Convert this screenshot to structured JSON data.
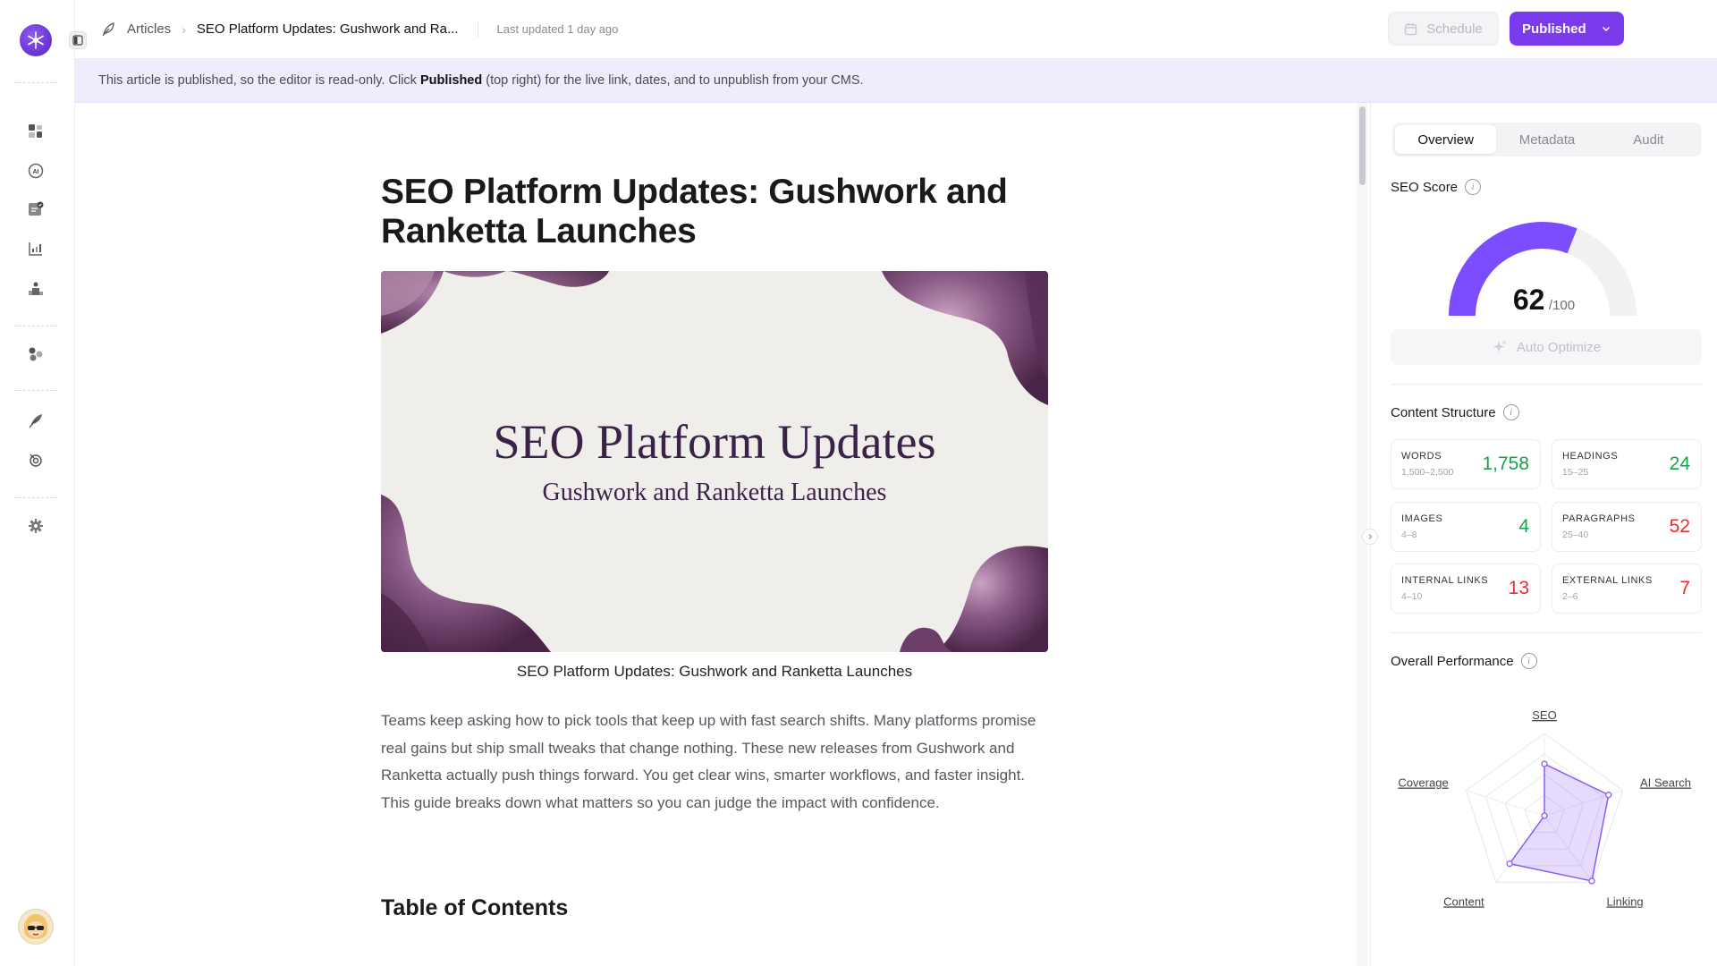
{
  "topbar": {
    "breadcrumb_root": "Articles",
    "breadcrumb_current": "SEO Platform Updates: Gushwork and Ra...",
    "last_updated": "Last updated 1 day ago",
    "schedule_label": "Schedule",
    "published_label": "Published"
  },
  "banner": {
    "text_before": "This article is published, so the editor is read-only. Click",
    "text_bold": "Published",
    "text_after": "(top right) for the live link, dates, and to unpublish from your CMS."
  },
  "article": {
    "title": "SEO Platform Updates: Gushwork and Ranketta Launches",
    "hero_title": "SEO Platform Updates",
    "hero_subtitle": "Gushwork and Ranketta Launches",
    "caption": "SEO Platform Updates: Gushwork and Ranketta Launches",
    "lead": "Teams keep asking how to pick tools that keep up with fast search shifts. Many platforms promise real gains but ship small tweaks that change nothing. These new releases from Gushwork and Ranketta actually push things forward. You get clear wins, smarter workflows, and faster insight. This guide breaks down what matters so you can judge the impact with confidence.",
    "toc_heading": "Table of Contents"
  },
  "panel": {
    "tabs": [
      {
        "label": "Overview",
        "active": true
      },
      {
        "label": "Metadata",
        "active": false
      },
      {
        "label": "Audit",
        "active": false
      }
    ],
    "seo_score": {
      "title": "SEO Score",
      "value": 62,
      "max_label": "/100",
      "fraction": 0.62,
      "color": "#7c4dff"
    },
    "auto_optimize_label": "Auto Optimize",
    "content_structure": {
      "title": "Content Structure",
      "metrics": [
        {
          "label": "WORDS",
          "range": "1,500–2,500",
          "value": "1,758",
          "status": "good"
        },
        {
          "label": "HEADINGS",
          "range": "15–25",
          "value": "24",
          "status": "good"
        },
        {
          "label": "IMAGES",
          "range": "4–8",
          "value": "4",
          "status": "good"
        },
        {
          "label": "PARAGRAPHS",
          "range": "25–40",
          "value": "52",
          "status": "bad"
        },
        {
          "label": "INTERNAL LINKS",
          "range": "4–10",
          "value": "13",
          "status": "bad"
        },
        {
          "label": "EXTERNAL LINKS",
          "range": "2–6",
          "value": "7",
          "status": "bad"
        }
      ]
    },
    "performance": {
      "title": "Overall Performance",
      "axes": [
        "SEO",
        "AI Search",
        "Linking",
        "Content",
        "Coverage"
      ],
      "values": [
        0.63,
        0.82,
        0.98,
        0.72,
        0.0
      ],
      "color": "#8b5cf6"
    }
  }
}
